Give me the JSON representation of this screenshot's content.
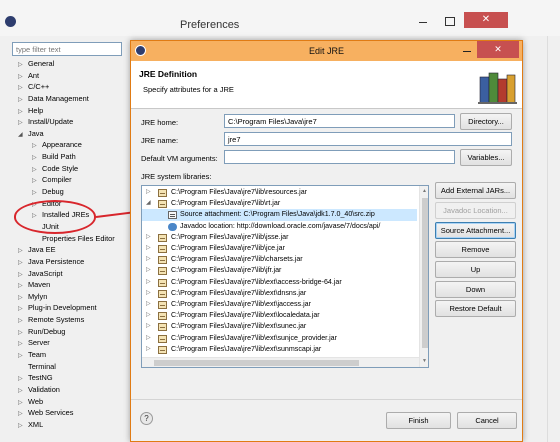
{
  "preferences": {
    "title": "Preferences",
    "filter_placeholder": "type filter text",
    "tree": [
      {
        "label": "General",
        "level": 0,
        "expanded": false
      },
      {
        "label": "Ant",
        "level": 0,
        "expanded": false
      },
      {
        "label": "C/C++",
        "level": 0,
        "expanded": false
      },
      {
        "label": "Data Management",
        "level": 0,
        "expanded": false
      },
      {
        "label": "Help",
        "level": 0,
        "expanded": false
      },
      {
        "label": "Install/Update",
        "level": 0,
        "expanded": false
      },
      {
        "label": "Java",
        "level": 0,
        "expanded": true
      },
      {
        "label": "Appearance",
        "level": 1,
        "expanded": false
      },
      {
        "label": "Build Path",
        "level": 1,
        "expanded": false
      },
      {
        "label": "Code Style",
        "level": 1,
        "expanded": false
      },
      {
        "label": "Compiler",
        "level": 1,
        "expanded": false
      },
      {
        "label": "Debug",
        "level": 1,
        "expanded": false
      },
      {
        "label": "Editor",
        "level": 1,
        "expanded": false
      },
      {
        "label": "Installed JREs",
        "level": 1,
        "expanded": false
      },
      {
        "label": "JUnit",
        "level": 1,
        "leaf": true
      },
      {
        "label": "Properties Files Editor",
        "level": 1,
        "leaf": true
      },
      {
        "label": "Java EE",
        "level": 0,
        "expanded": false
      },
      {
        "label": "Java Persistence",
        "level": 0,
        "expanded": false
      },
      {
        "label": "JavaScript",
        "level": 0,
        "expanded": false
      },
      {
        "label": "Maven",
        "level": 0,
        "expanded": false
      },
      {
        "label": "Mylyn",
        "level": 0,
        "expanded": false
      },
      {
        "label": "Plug-in Development",
        "level": 0,
        "expanded": false
      },
      {
        "label": "Remote Systems",
        "level": 0,
        "expanded": false
      },
      {
        "label": "Run/Debug",
        "level": 0,
        "expanded": false
      },
      {
        "label": "Server",
        "level": 0,
        "expanded": false
      },
      {
        "label": "Team",
        "level": 0,
        "expanded": false
      },
      {
        "label": "Terminal",
        "level": 0,
        "leaf": true
      },
      {
        "label": "TestNG",
        "level": 0,
        "expanded": false
      },
      {
        "label": "Validation",
        "level": 0,
        "expanded": false
      },
      {
        "label": "Web",
        "level": 0,
        "expanded": false
      },
      {
        "label": "Web Services",
        "level": 0,
        "expanded": false
      },
      {
        "label": "XML",
        "level": 0,
        "expanded": false
      }
    ]
  },
  "dialog": {
    "title": "Edit JRE",
    "heading": "JRE Definition",
    "subheading": "Specify attributes for a JRE",
    "jre_home_label": "JRE home:",
    "jre_home_value": "C:\\Program Files\\Java\\jre7",
    "jre_name_label": "JRE name:",
    "jre_name_value": "jre7",
    "vm_args_label": "Default VM arguments:",
    "vm_args_value": "",
    "libraries_label": "JRE system libraries:",
    "buttons": {
      "directory": "Directory...",
      "variables": "Variables...",
      "add_external_jars": "Add External JARs...",
      "javadoc_location": "Javadoc Location...",
      "source_attachment": "Source Attachment...",
      "remove": "Remove",
      "up": "Up",
      "down": "Down",
      "restore_default": "Restore Default",
      "finish": "Finish",
      "cancel": "Cancel"
    },
    "help_symbol": "?",
    "libraries": [
      {
        "text": "C:\\Program Files\\Java\\jre7\\lib\\resources.jar",
        "kind": "jar",
        "expanded": false
      },
      {
        "text": "C:\\Program Files\\Java\\jre7\\lib\\rt.jar",
        "kind": "jar",
        "expanded": true
      },
      {
        "text": "Source attachment: C:\\Program Files\\Java\\jdk1.7.0_40\\src.zip",
        "kind": "source",
        "selected": true
      },
      {
        "text": "Javadoc location: http://download.oracle.com/javase/7/docs/api/",
        "kind": "javadoc"
      },
      {
        "text": "C:\\Program Files\\Java\\jre7\\lib\\jsse.jar",
        "kind": "jar",
        "expanded": false
      },
      {
        "text": "C:\\Program Files\\Java\\jre7\\lib\\jce.jar",
        "kind": "jar",
        "expanded": false
      },
      {
        "text": "C:\\Program Files\\Java\\jre7\\lib\\charsets.jar",
        "kind": "jar",
        "expanded": false
      },
      {
        "text": "C:\\Program Files\\Java\\jre7\\lib\\jfr.jar",
        "kind": "jar",
        "expanded": false
      },
      {
        "text": "C:\\Program Files\\Java\\jre7\\lib\\ext\\access-bridge-64.jar",
        "kind": "jar",
        "expanded": false
      },
      {
        "text": "C:\\Program Files\\Java\\jre7\\lib\\ext\\dnsns.jar",
        "kind": "jar",
        "expanded": false
      },
      {
        "text": "C:\\Program Files\\Java\\jre7\\lib\\ext\\jaccess.jar",
        "kind": "jar",
        "expanded": false
      },
      {
        "text": "C:\\Program Files\\Java\\jre7\\lib\\ext\\localedata.jar",
        "kind": "jar",
        "expanded": false
      },
      {
        "text": "C:\\Program Files\\Java\\jre7\\lib\\ext\\sunec.jar",
        "kind": "jar",
        "expanded": false
      },
      {
        "text": "C:\\Program Files\\Java\\jre7\\lib\\ext\\sunjce_provider.jar",
        "kind": "jar",
        "expanded": false
      },
      {
        "text": "C:\\Program Files\\Java\\jre7\\lib\\ext\\sunmscapi.jar",
        "kind": "jar",
        "expanded": false
      }
    ]
  },
  "colors": {
    "dialog_title_bar": "#f7b060",
    "close_button": "#c75050",
    "annotation": "#d8262c",
    "selection": "#cce8ff"
  }
}
